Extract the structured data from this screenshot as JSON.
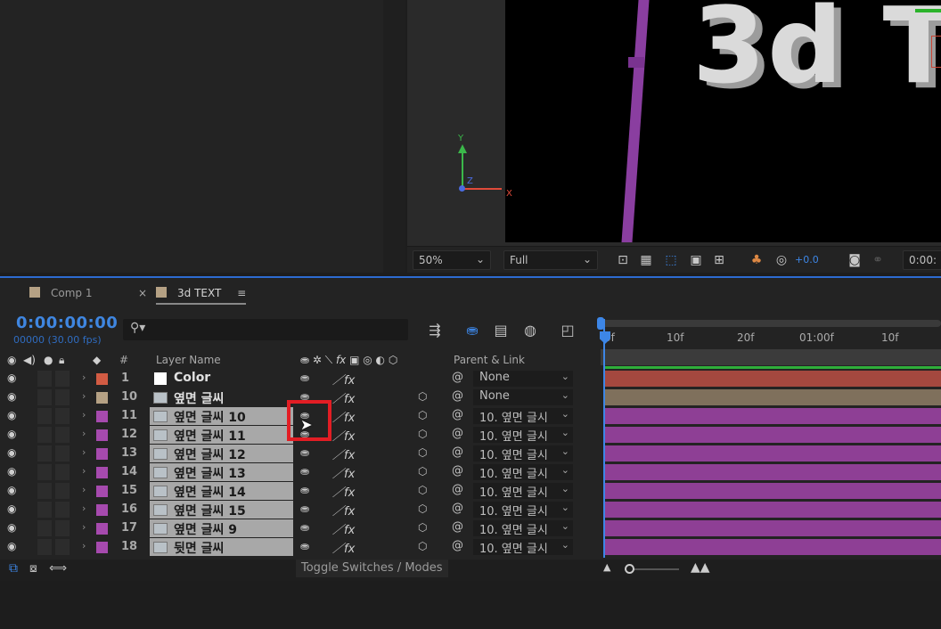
{
  "viewer": {
    "text_3d": "3d T",
    "axis_y": "Y",
    "axis_z": "Z",
    "axis_x": "X",
    "zoom": "50%",
    "resolution": "Full",
    "exposure": "+0.0",
    "timecode_cut": "0:00:"
  },
  "tabs": [
    {
      "label": "Comp 1",
      "color": "#b5a184"
    },
    {
      "label": "3d TEXT",
      "color": "#b5a184",
      "active": true
    }
  ],
  "tab_close": "×",
  "tab_menu": "≡",
  "timeline": {
    "timecode": "0:00:00:00",
    "fps": "00000 (30.00 fps)",
    "search_placeholder": ""
  },
  "columns": {
    "hash": "#",
    "layer_name": "Layer Name",
    "parent_link": "Parent & Link"
  },
  "ruler_labels": [
    "0f",
    "10f",
    "20f",
    "01:00f",
    "10f"
  ],
  "layers": [
    {
      "num": "1",
      "name": "Color",
      "label_color": "#d25b43",
      "parent": "None",
      "type": "solid",
      "bar_color": "#a4483f"
    },
    {
      "num": "10",
      "name": "옆면 글씨",
      "label_color": "#b5a184",
      "parent": "None",
      "type": "plain",
      "bar_color": "#7f705c"
    },
    {
      "num": "11",
      "name": "옆면 글씨 10",
      "label_color": "#a64aae",
      "parent": "10. 옆면 글시",
      "type": "comp",
      "bar_color": "#8e3f95"
    },
    {
      "num": "12",
      "name": "옆면 글씨 11",
      "label_color": "#a64aae",
      "parent": "10. 옆면 글시",
      "type": "comp",
      "bar_color": "#8e3f95"
    },
    {
      "num": "13",
      "name": "옆면 글씨 12",
      "label_color": "#a64aae",
      "parent": "10. 옆면 글시",
      "type": "comp",
      "bar_color": "#8e3f95"
    },
    {
      "num": "14",
      "name": "옆면 글씨 13",
      "label_color": "#a64aae",
      "parent": "10. 옆면 글시",
      "type": "comp",
      "bar_color": "#8e3f95"
    },
    {
      "num": "15",
      "name": "옆면 글씨 14",
      "label_color": "#a64aae",
      "parent": "10. 옆면 글시",
      "type": "comp",
      "bar_color": "#8e3f95"
    },
    {
      "num": "16",
      "name": "옆면 글씨 15",
      "label_color": "#a64aae",
      "parent": "10. 옆면 글시",
      "type": "comp",
      "bar_color": "#8e3f95"
    },
    {
      "num": "17",
      "name": "옆면 글씨 9",
      "label_color": "#a64aae",
      "parent": "10. 옆면 글시",
      "type": "comp",
      "bar_color": "#8e3f95"
    },
    {
      "num": "18",
      "name": "뒷면 글씨",
      "label_color": "#a64aae",
      "parent": "10. 옆면 글시",
      "type": "comp",
      "bar_color": "#8e3f95"
    }
  ],
  "footer": {
    "toggle_label": "Toggle Switches / Modes"
  },
  "colors": {
    "accent": "#3d86e6",
    "highlight": "#e21d24"
  }
}
